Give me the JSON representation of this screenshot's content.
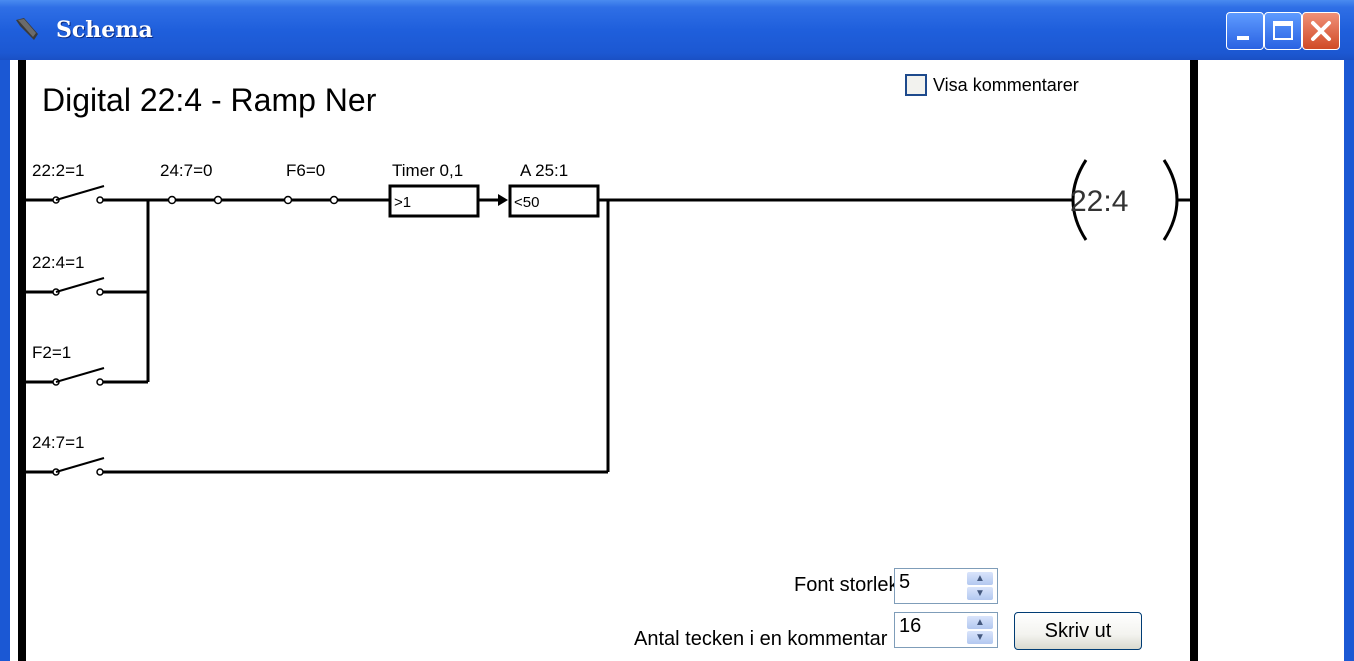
{
  "window": {
    "title": "Schema",
    "accent": "#1f5fdc",
    "controls": [
      "minimize-icon",
      "maximize-icon",
      "close-icon"
    ]
  },
  "page": {
    "heading": "Digital 22:4 - Ramp Ner",
    "show_comments_label": "Visa kommentarer",
    "show_comments_checked": false
  },
  "ladder": {
    "contacts": [
      {
        "label": "22:2=1"
      },
      {
        "label": "24:7=0"
      },
      {
        "label": "F6=0"
      },
      {
        "label": "22:4=1"
      },
      {
        "label": "F2=1"
      },
      {
        "label": "24:7=1"
      }
    ],
    "blocks": [
      {
        "title": "Timer 0,1",
        "value": ">1"
      },
      {
        "title": "A 25:1",
        "value": "<50"
      }
    ],
    "coil": {
      "label": "22:4"
    }
  },
  "settings": {
    "font_size_label": "Font storlek",
    "font_size_value": "5",
    "comment_chars_label": "Antal tecken i en kommentar",
    "comment_chars_value": "16",
    "print_button": "Skriv ut"
  }
}
